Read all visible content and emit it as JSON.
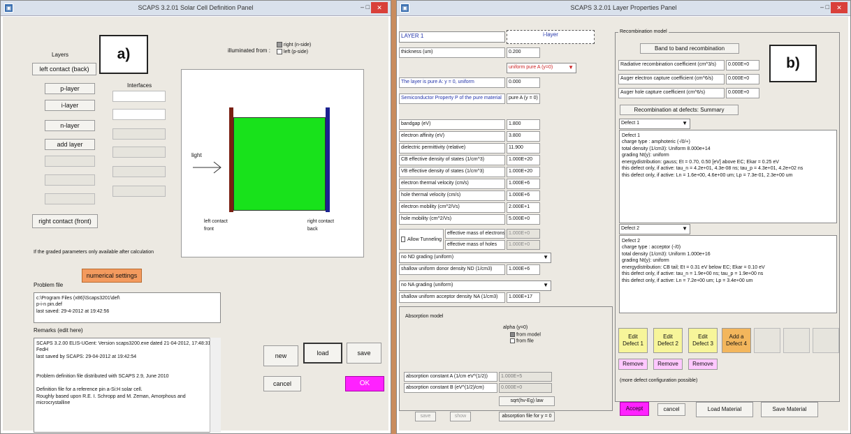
{
  "left": {
    "title": "SCAPS 3.2.01 Solar Cell Definition Panel",
    "marker": "a)",
    "layers_label": "Layers",
    "left_contact": "left contact (back)",
    "layers": [
      "p-layer",
      "i-layer",
      "n-layer"
    ],
    "add_layer": "add layer",
    "interfaces_label": "Interfaces",
    "right_contact": "right contact (front)",
    "illuminated_label": "illuminated from :",
    "illum_options": [
      "right (n-side)",
      "left (p-side)"
    ],
    "light": "light",
    "left_contact_caption": "left contact\nfront",
    "right_contact_caption": "right contact\nback",
    "graded_note": "If the graded parameters only available after calculation",
    "numerical_settings": "numerical settings",
    "problem_file_label": "Problem file",
    "problem_file_text": "c:\\Program Files (x86)\\Scaps3201\\def\\\np-i-n pin.def\nlast saved: 29-4-2012 at 19:42:56",
    "remarks_label": "Remarks (edit here)",
    "remarks_text": "SCAPS 3.2.00 ELIS-UGent: Version scaps3200.exe dated 21-04-2012, 17:48:31 FedH\nlast saved by SCAPS: 29-04-2012 at 19:42:54\n\n\nProblem definition file distributed with SCAPS 2.9, June 2010\n\nDefinition file for a reference pin a-Si:H solar cell.\nRoughly based upon R.E. I. Schropp and M. Zeman, Amorphous and microcrystalline",
    "new": "new",
    "load": "load",
    "save": "save",
    "cancel": "cancel",
    "ok": "OK"
  },
  "right": {
    "title": "SCAPS 3.2.01 Layer Properties Panel",
    "marker": "b)",
    "layer_name": "LAYER 1",
    "layer_type": "i-layer",
    "thickness_label": "thickness (um)",
    "thickness_value": "0.200",
    "uniform_select": "uniform pure A (y=0)",
    "pure_label": "The layer is pure A: y = 0, uniform",
    "pure_value": "0.000",
    "semi_label": "Semiconductor Property P of the pure material",
    "semi_value": "pure A (y = 0)",
    "props": [
      {
        "label": "bandgap (eV)",
        "value": "1.800"
      },
      {
        "label": "electron affinity (eV)",
        "value": "3.800"
      },
      {
        "label": "dielectric permittivity (relative)",
        "value": "11.900"
      },
      {
        "label": "CB effective density of states (1/cm^3)",
        "value": "1.000E+20"
      },
      {
        "label": "VB effective density of states (1/cm^3)",
        "value": "1.000E+20"
      },
      {
        "label": "electron thermal velocity (cm/s)",
        "value": "1.000E+6"
      },
      {
        "label": "hole thermal velocity (cm/s)",
        "value": "1.000E+6"
      },
      {
        "label": "electron mobility (cm^2/Vs)",
        "value": "2.000E+1"
      },
      {
        "label": "hole mobility (cm^2/Vs)",
        "value": "5.000E+0"
      }
    ],
    "allow_tunneling": "Allow Tunneling",
    "eff_mass_e": "effective mass of electrons",
    "eff_mass_e_val": "1.000E+0",
    "eff_mass_h": "effective mass of holes",
    "eff_mass_h_val": "1.000E+0",
    "nd_grading": "no ND grading (uniform)",
    "nd_label": "shallow uniform donor density ND (1/cm3)",
    "nd_value": "1.000E+6",
    "na_grading": "no NA grading (uniform)",
    "na_label": "shallow uniform acceptor density NA (1/cm3)",
    "na_value": "1.000E+17",
    "absorption_label": "Absorption model",
    "alpha_label": "alpha (y=0)",
    "alpha_options": [
      "from model",
      "from file"
    ],
    "abs_a_label": "absorption constant A (1/cm eV^(1/2))",
    "abs_a_value": "1.000E+5",
    "abs_b_label": "absorption constant B (eV^(1/2)/cm)",
    "abs_b_value": "0.000E+0",
    "sqrt_btn": "sqrt(hv-Eg) law",
    "save_btn": "save",
    "show_btn": "show",
    "abs_file_btn": "absorption file for y = 0",
    "recomb_label": "Recombination model",
    "band_to_band": "Band to band recombination",
    "rad_label": "Radiative recombination coefficient (cm^3/s)",
    "rad_value": "0.000E+0",
    "auger_e_label": "Auger electron capture coefficient (cm^6/s)",
    "auger_e_value": "0.000E+0",
    "auger_h_label": "Auger hole capture coefficient (cm^6/s)",
    "auger_h_value": "0.000E+0",
    "defects_summary": "Recombination at defects: Summary",
    "defect1_select": "Defect 1",
    "defect1_text": "Defect 1\ncharge type : amphoteric (-/0/+)\ntotal density (1/cm3): Uniform 8.000e+14\ngrading Nt(y): uniform\nenergydistribution: gauss; Et = 0.70, 0.50 [eV] above EC; Ekar = 0.25 eV\nthis defect only, if active: tau_n = 4.2e+01, 4.3e-08 ns; tau_p = 4.3e+01, 4.2e+02 ns\nthis defect only, if active: Ln = 1.6e+00, 4.6e+00 um; Lp = 7.3e-01, 2.3e+00 um",
    "defect2_select": "Defect 2",
    "defect2_text": "Defect 2\ncharge type : acceptor (-/0)\ntotal density (1/cm3): Uniform 1.000e+16\ngrading Nt(y): uniform\nenergydistribution: CB tail; Et = 0.31 eV below EC; Ekar = 0.10 eV\nthis defect only, if active: tau_n = 1.9e+00 ns; tau_p = 1.9e+00 ns\nthis defect only, if active: Ln = 7.2e+00 um; Lp = 3.4e+00 um",
    "edit_defects": [
      "Edit\nDefect 1",
      "Edit\nDefect 2",
      "Edit\nDefect 3",
      "Add a\nDefect 4"
    ],
    "remove": [
      "Remove",
      "Remove",
      "Remove"
    ],
    "config_note": "(more defect configuration possible)",
    "accept": "Accept",
    "cancel": "cancel",
    "load_material": "Load Material",
    "save_material": "Save Material"
  }
}
